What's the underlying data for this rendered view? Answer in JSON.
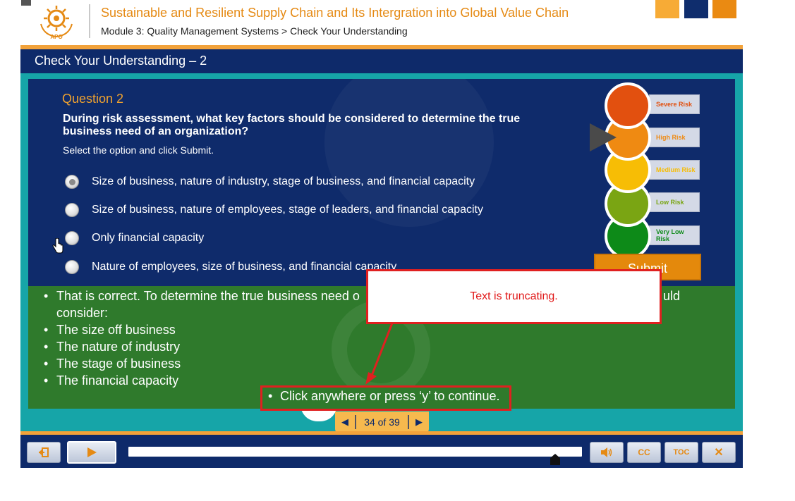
{
  "header": {
    "course_title": "Sustainable and Resilient Supply Chain and Its Intergration into Global Value Chain",
    "breadcrumb": "Module 3: Quality Management Systems > Check Your Understanding",
    "logo_text": "APO"
  },
  "slide": {
    "title": "Check Your Understanding – 2"
  },
  "question": {
    "number": "Question 2",
    "text": "During risk assessment, what key factors should be considered to determine the true business need of an organization?",
    "instruction": "Select the option and click Submit.",
    "options": [
      {
        "label": "Size of business, nature of industry, stage of business, and financial capacity",
        "selected": true
      },
      {
        "label": "Size of business, nature of employees, stage of leaders, and financial capacity",
        "selected": false
      },
      {
        "label": "Only financial capacity",
        "selected": false
      },
      {
        "label": "Nature of employees, size of business, and financial capacity",
        "selected": false
      }
    ]
  },
  "risk_meter": {
    "levels": [
      {
        "label": "Severe Risk",
        "color": "#e2500f"
      },
      {
        "label": "High Risk",
        "color": "#ef8a12"
      },
      {
        "label": "Medium Risk",
        "color": "#f7bd05"
      },
      {
        "label": "Low Risk",
        "color": "#7aa513"
      },
      {
        "label": "Very Low Risk",
        "color": "#0d8a18"
      }
    ],
    "indicator_level": "High Risk"
  },
  "submit_label": "Submit",
  "feedback": {
    "intro_visible": "That is correct.  To determine the true business need o",
    "intro_continuation": "consider:",
    "intro_tail": "uld",
    "items": [
      "The size off business",
      "The nature of industry",
      "The stage of business",
      "The financial capacity"
    ],
    "continue_text": "Click anywhere or press ‘y’ to continue."
  },
  "annotation": {
    "text": "Text is truncating."
  },
  "page_nav": {
    "counter": "34 of 39"
  },
  "player": {
    "progress_fraction": 0.94,
    "buttons": {
      "cc": "CC",
      "toc": "TOC"
    }
  },
  "colors": {
    "navy": "#0e2a6a",
    "orange": "#f2a23a",
    "teal": "#16a5a8",
    "feedback_green": "#2f7a2c",
    "annotation_red": "#e02020"
  }
}
